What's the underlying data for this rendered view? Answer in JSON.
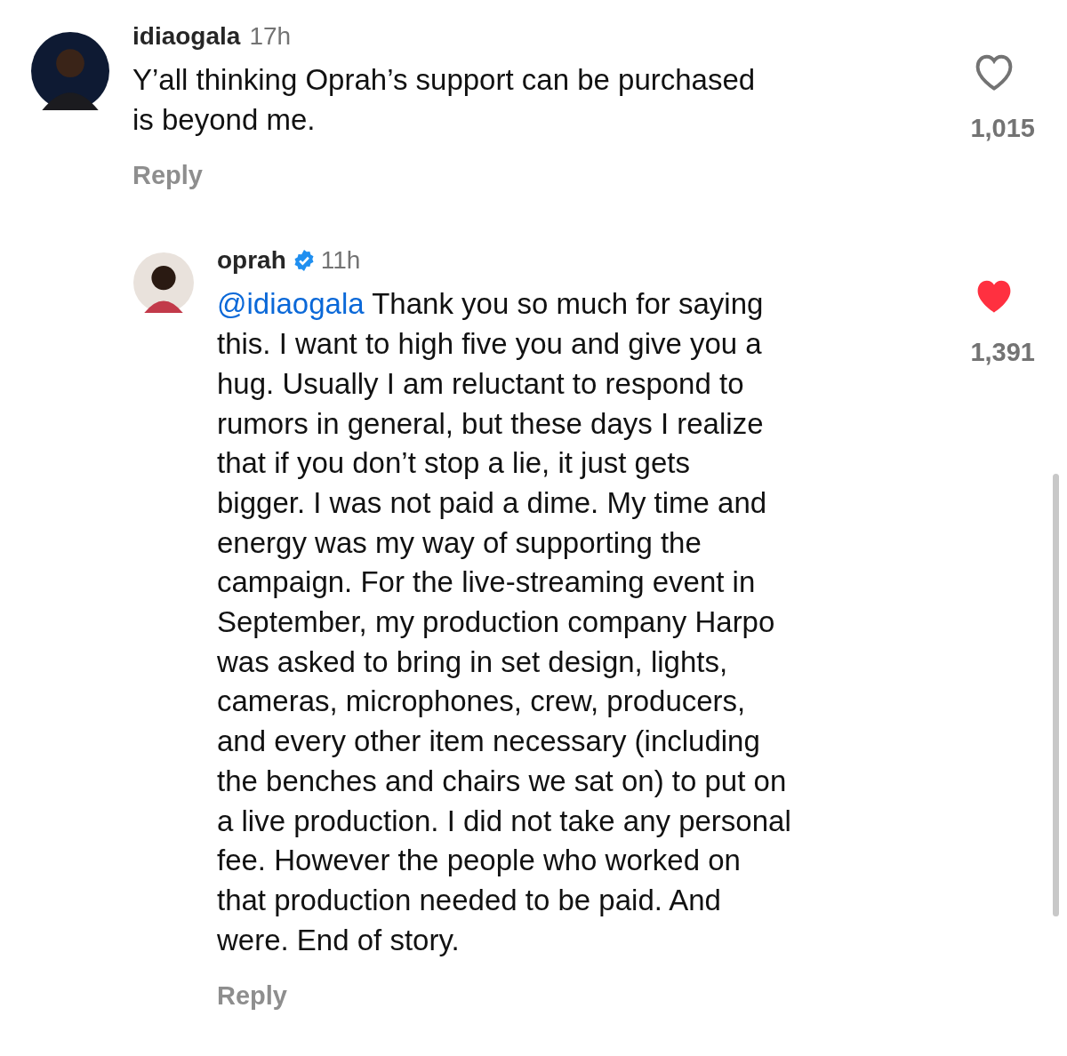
{
  "comments": [
    {
      "username": "idiaogala",
      "verified": false,
      "time": "17h",
      "text": "Y’all thinking Oprah’s support can be purchased\nis beyond me.",
      "liked": false,
      "likes": "1,015",
      "reply": "Reply",
      "nested": false
    },
    {
      "username": "oprah",
      "verified": true,
      "time": "11h",
      "mention": "@idiaogala",
      "text": " Thank you so much for saying\nthis. I want to high five you and give you a\nhug. Usually I am reluctant to respond to\nrumors in general, but these days I realize\nthat if you don’t stop a lie, it just gets\nbigger. I was not paid a dime. My time and\nenergy was my way of supporting the\ncampaign. For the live-streaming event in\nSeptember, my production company Harpo\nwas asked to bring in set design, lights,\ncameras, microphones, crew, producers,\nand every other item necessary (including\nthe benches and chairs we sat on) to put on\na live production. I did not take any personal\nfee. However the people who worked on\nthat production needed to be paid. And\nwere. End of story.",
      "liked": true,
      "likes": "1,391",
      "reply": "Reply",
      "nested": true
    }
  ]
}
